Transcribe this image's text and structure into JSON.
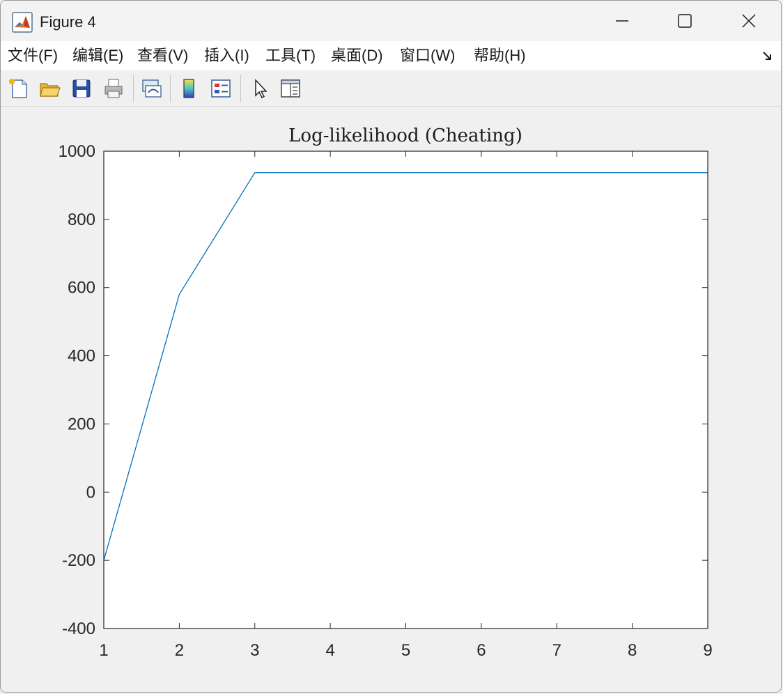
{
  "window": {
    "title": "Figure 4",
    "icon": "matlab-icon",
    "controls": [
      "minimize-icon",
      "maximize-icon",
      "close-icon"
    ]
  },
  "menu": {
    "items": [
      {
        "label": "文件(F)",
        "key": "F"
      },
      {
        "label": "编辑(E)",
        "key": "E"
      },
      {
        "label": "查看(V)",
        "key": "V"
      },
      {
        "label": "插入(I)",
        "key": "I"
      },
      {
        "label": "工具(T)",
        "key": "T"
      },
      {
        "label": "桌面(D)",
        "key": "D"
      },
      {
        "label": "窗口(W)",
        "key": "W"
      },
      {
        "label": "帮助(H)",
        "key": "H"
      }
    ]
  },
  "toolbar": {
    "tools": [
      "new-figure-icon",
      "open-file-icon",
      "save-icon",
      "print-icon",
      "link-plot-icon",
      "colorbar-icon",
      "legend-icon",
      "pointer-icon",
      "property-editor-icon"
    ]
  },
  "colors": {
    "line": "#0072bd",
    "axes_bg": "#ffffff",
    "figure_bg": "#f0f0f0"
  },
  "chart_data": {
    "type": "line",
    "title": "Log-likelihood (Cheating)",
    "x": [
      1,
      2,
      3,
      4,
      5,
      6,
      7,
      8,
      9
    ],
    "series": [
      {
        "values": [
          -200,
          580,
          937,
          937,
          937,
          937,
          937,
          937,
          937
        ]
      }
    ],
    "xlim": [
      1,
      9
    ],
    "ylim": [
      -400,
      1000
    ],
    "xticks": [
      1,
      2,
      3,
      4,
      5,
      6,
      7,
      8,
      9
    ],
    "yticks": [
      -400,
      -200,
      0,
      200,
      400,
      600,
      800,
      1000
    ],
    "xlabel": "",
    "ylabel": "",
    "grid": false,
    "legend": "none"
  }
}
